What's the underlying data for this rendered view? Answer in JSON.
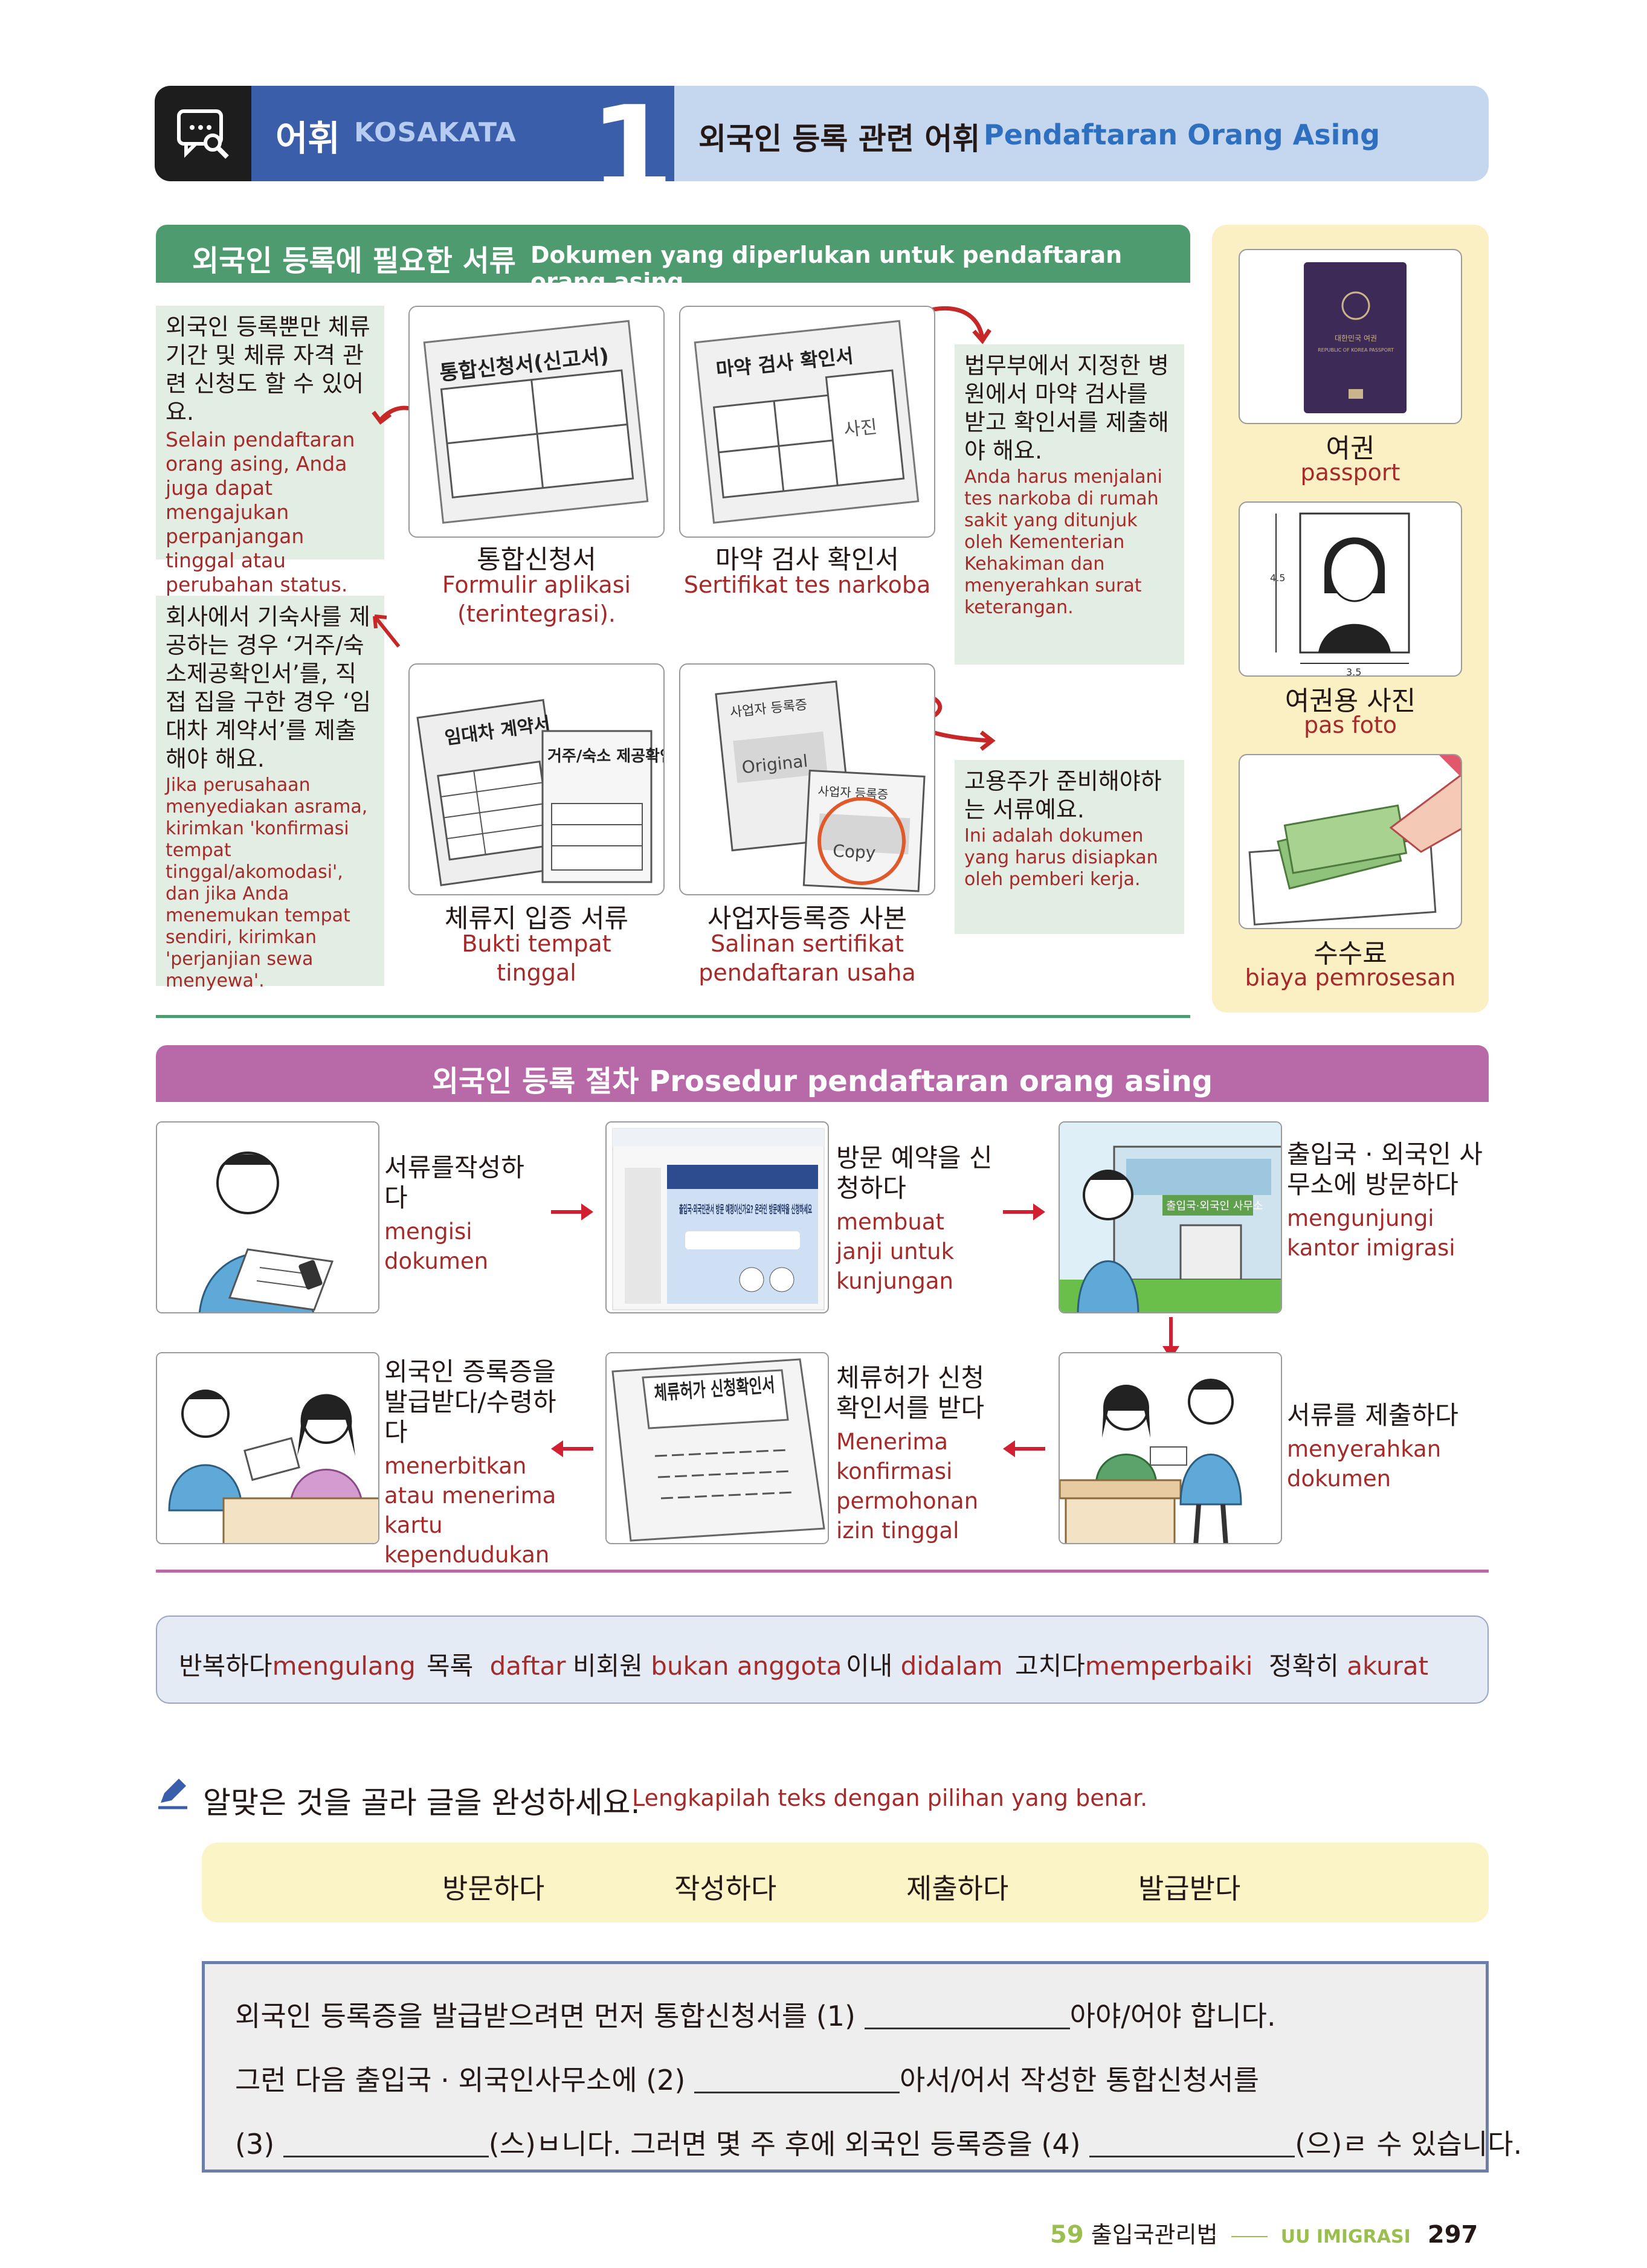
{
  "header": {
    "section_ko": "어휘",
    "section_id": "KOSAKATA",
    "number": "1",
    "topic_ko": "외국인 등록 관련 어휘",
    "topic_id": "Pendaftaran Orang Asing"
  },
  "documents": {
    "title_ko": "외국인 등록에 필요한 서류",
    "title_id": "Dokumen yang diperlukan untuk pendaftaran orang asing",
    "notes": [
      {
        "ko": "외국인 등록뿐만 체류 기간 및 체류 자격 관련 신청도 할 수 있어요.",
        "id": "Selain pendaftaran orang asing, Anda juga dapat mengajukan perpanjangan tinggal atau perubahan status."
      },
      {
        "ko": "법무부에서 지정한 병원에서 마약 검사를 받고 확인서를 제출해야 해요.",
        "id": "Anda harus menjalani tes narkoba di rumah sakit yang ditunjuk oleh Kementerian Kehakiman dan menyerahkan surat keterangan."
      },
      {
        "ko": "회사에서 기숙사를 제공하는 경우 ‘거주/숙소제공확인서’를, 직접 집을 구한 경우 ‘임대차 계약서’를 제출해야 해요.",
        "id": "Jika perusahaan menyediakan asrama, kirimkan 'konfirmasi tempat tinggal/akomodasi', dan jika Anda menemukan tempat sendiri, kirimkan 'perjanjian sewa menyewa'."
      },
      {
        "ko": "고용주가 준비해야하는 서류예요.",
        "id": "Ini adalah dokumen yang harus disiapkan oleh pemberi kerja."
      }
    ],
    "items": [
      {
        "ko": "통합신청서",
        "id": "Formulir aplikasi (terintegrasi).",
        "img_label": "통합신청서(신고서)"
      },
      {
        "ko": "마약 검사 확인서",
        "id": "Sertifikat tes narkoba",
        "img_label": "마약 검사 확인서",
        "img_photo": "사진"
      },
      {
        "ko": "체류지 입증 서류",
        "id": "Bukti tempat tinggal",
        "img_label_a": "임대차 계약서",
        "img_label_b": "거주/숙소 제공확인서"
      },
      {
        "ko": "사업자등록증 사본",
        "id": "Salinan sertifikat pendaftaran usaha",
        "img_label": "사업자 등록증",
        "img_original": "Original",
        "img_copy": "Copy"
      }
    ],
    "side": [
      {
        "ko": "여권",
        "id": "passport",
        "img_text_a": "대한민국 여권",
        "img_text_b": "REPUBLIC OF KOREA PASSPORT"
      },
      {
        "ko": "여권용 사진",
        "id": "pas foto",
        "img_dim_h": "4.5",
        "img_dim_w": "3.5"
      },
      {
        "ko": "수수료",
        "id": "biaya pemrosesan"
      }
    ]
  },
  "procedure": {
    "title": "외국인 등록 절차 Prosedur pendaftaran orang asing",
    "steps": [
      {
        "ko": "서류를작성하다",
        "id": "mengisi dokumen"
      },
      {
        "ko": "방문 예약을 신청하다",
        "id": "membuat janji untuk kunjungan"
      },
      {
        "ko": "출입국 · 외국인 사무소에 방문하다",
        "id": "mengunjungi kantor imigrasi"
      },
      {
        "ko": "서류를 제출하다",
        "id": "menyerahkan dokumen"
      },
      {
        "ko": "체류허가 신청 확인서를 받다",
        "id": "Menerima konfirmasi permohonan izin tinggal"
      },
      {
        "ko": "외국인 증록증을 발급받다/수령하다",
        "id": "menerbitkan atau menerima kartu kependudukan"
      }
    ],
    "img_office_sign": "출입국·외국인 사무소",
    "img_web_text": "출입국·외국인관서 방문 예정이신가요? 온라인 방문예약을 신청하세요",
    "img_cert_label": "체류허가 신청확인서"
  },
  "vocab": [
    {
      "ko": "반복하다",
      "id": "mengulang"
    },
    {
      "ko": "목록",
      "id": "daftar"
    },
    {
      "ko": "비회원",
      "id": "bukan anggota"
    },
    {
      "ko": "이내",
      "id": "didalam"
    },
    {
      "ko": "고치다",
      "id": "memperbaiki"
    },
    {
      "ko": "정확히",
      "id": "akurat"
    }
  ],
  "exercise": {
    "instruction_ko": "알맞은 것을 골라 글을 완성하세요.",
    "instruction_id": "Lengkapilah teks dengan pilihan yang benar.",
    "options": [
      "방문하다",
      "작성하다",
      "제출하다",
      "발급받다"
    ],
    "line1_a": "외국인 등록증을 발급받으려면 먼저 통합신청서를 (1) ",
    "line1_b": "아야/어야 합니다.",
    "line2_a": "그런 다음 출입국 · 외국인사무소에 (2) ",
    "line2_b": "아서/어서 작성한 통합신청서를",
    "line3_a": "(3) ",
    "line3_b": "(스)ㅂ니다. 그러면 몇 주 후에 외국인 등록증을 (4) ",
    "line3_c": "(으)ㄹ 수 있습니다."
  },
  "footer": {
    "chapter": "59",
    "law_ko": "출입국관리법",
    "law_id": "UU IMIGRASI",
    "page": "297"
  },
  "colors": {
    "header_blue": "#3a5ea9",
    "topic_blue": "#c5d7ef",
    "green": "#4e9b6f",
    "magenta": "#b86aa8",
    "indonesian_text": "#a52a2a",
    "arrow_red": "#d02031"
  }
}
